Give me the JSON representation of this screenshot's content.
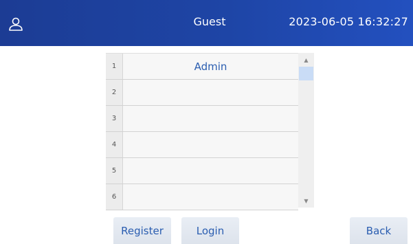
{
  "header": {
    "user": "Guest",
    "datetime": "2023-06-05 16:32:27",
    "icon": "user-icon"
  },
  "table": {
    "rows": [
      {
        "num": "1",
        "value": "Admin"
      },
      {
        "num": "2",
        "value": ""
      },
      {
        "num": "3",
        "value": ""
      },
      {
        "num": "4",
        "value": ""
      },
      {
        "num": "5",
        "value": ""
      },
      {
        "num": "6",
        "value": ""
      }
    ]
  },
  "buttons": {
    "register": "Register",
    "login": "Login",
    "back": "Back"
  },
  "colors": {
    "header": "#1e45a6",
    "accent_text": "#2a5db0",
    "scroll_thumb": "#c9dcf6"
  }
}
